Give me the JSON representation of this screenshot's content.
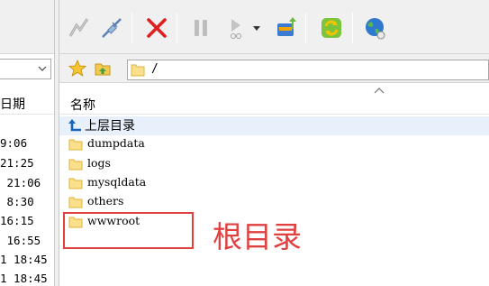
{
  "left_pane": {
    "header_label": "日期",
    "times": [
      "9:06",
      "21:25",
      " 21:06",
      " 8:30",
      "16:15",
      " 16:55",
      "1 18:45",
      "1 18:45"
    ]
  },
  "toolbar": {
    "buttons": [
      "connect",
      "disconnect",
      "cancel",
      "pause",
      "play",
      "dropdown",
      "transfer",
      "refresh",
      "globe"
    ]
  },
  "address": {
    "path": "/"
  },
  "file_list": {
    "column_name": "名称",
    "parent_label": "上层目录",
    "folders": [
      "dumpdata",
      "logs",
      "mysqldata",
      "others",
      "wwwroot"
    ]
  },
  "annotation": {
    "text": "根目录",
    "color": "#e0403f"
  }
}
